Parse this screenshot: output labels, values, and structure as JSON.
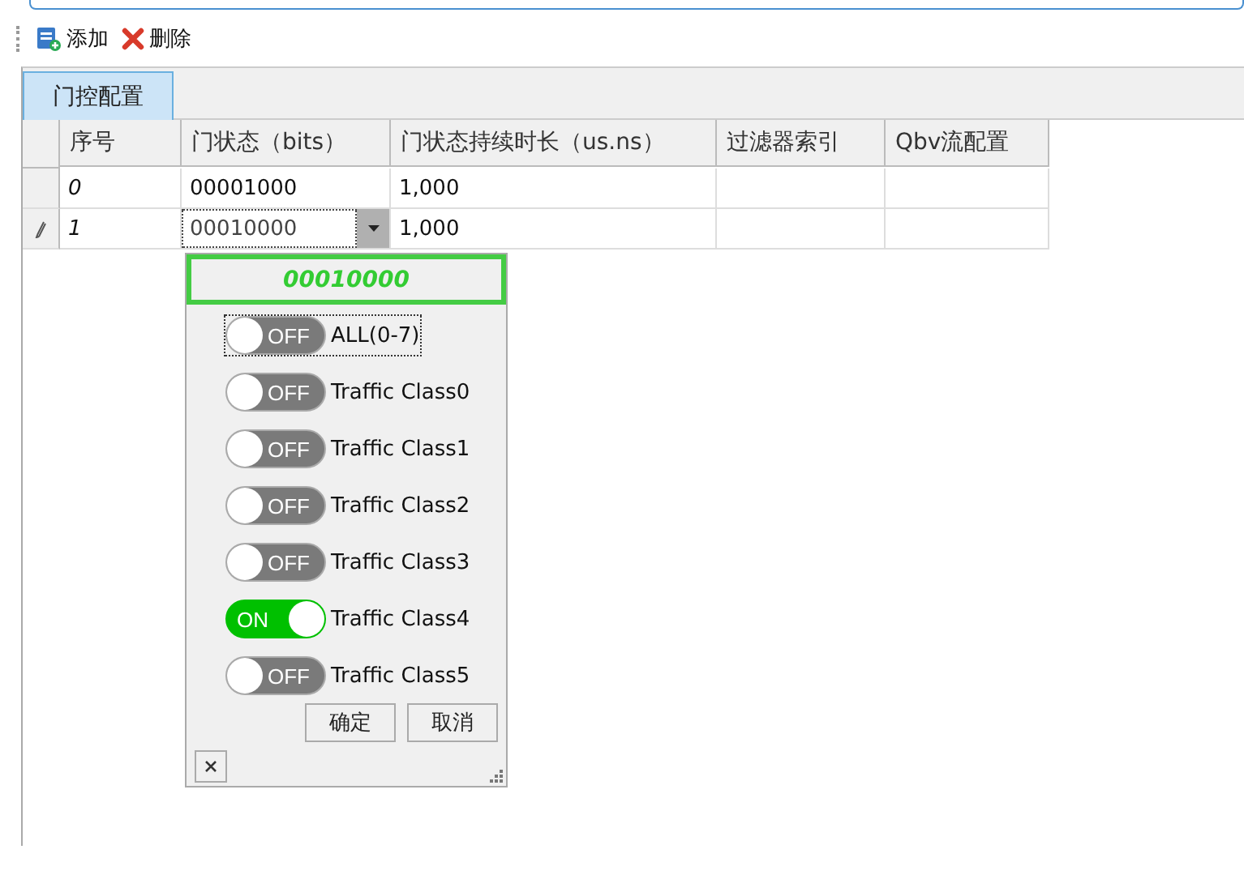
{
  "toolbar": [
    {
      "label": "添加",
      "kind": "add"
    },
    {
      "label": "删除",
      "kind": "delete"
    }
  ],
  "tabs": [
    {
      "label": "门控配置",
      "selected": true
    }
  ],
  "table": {
    "columns": [
      "序号",
      "门状态（bits）",
      "门状态持续时长（us.ns）",
      "过滤器索引",
      "Qbv流配置"
    ],
    "rows": [
      {
        "index": "0",
        "gate": "00001000",
        "duration": "1,000",
        "editing": false
      },
      {
        "index": "1",
        "gate": "00010000",
        "duration": "1,000",
        "editing": true
      }
    ]
  },
  "popup": {
    "value": "00010000",
    "toggles": [
      {
        "label": "ALL(0-7)",
        "on": false,
        "switch_text": "OFF",
        "focused": true
      },
      {
        "label": "Traffic Class0",
        "on": false,
        "switch_text": "OFF",
        "focused": false
      },
      {
        "label": "Traffic Class1",
        "on": false,
        "switch_text": "OFF",
        "focused": false
      },
      {
        "label": "Traffic Class2",
        "on": false,
        "switch_text": "OFF",
        "focused": false
      },
      {
        "label": "Traffic Class3",
        "on": false,
        "switch_text": "OFF",
        "focused": false
      },
      {
        "label": "Traffic Class4",
        "on": true,
        "switch_text": "ON",
        "focused": false
      },
      {
        "label": "Traffic Class5",
        "on": false,
        "switch_text": "OFF",
        "focused": false
      }
    ],
    "buttons": [
      "确定",
      "取消"
    ]
  }
}
